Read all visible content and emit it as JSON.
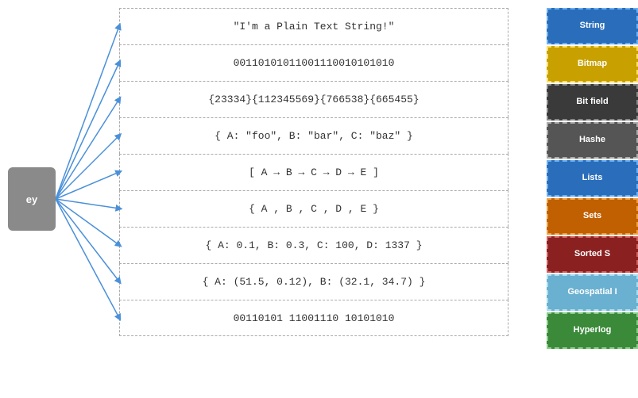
{
  "key": {
    "label": "ey"
  },
  "data_items": [
    {
      "id": "string-data",
      "text": "\"I'm a Plain Text String!\""
    },
    {
      "id": "bitmap-data",
      "text": "00110101011001110010101010"
    },
    {
      "id": "bitfield-data",
      "text": "{23334}{112345569}{766538}{665455}"
    },
    {
      "id": "hash-data",
      "text": "{ A: \"foo\", B: \"bar\", C: \"baz\" }"
    },
    {
      "id": "list-data",
      "text": "[ A → B → C → D → E ]"
    },
    {
      "id": "set-data",
      "text": "{ A , B , C , D , E }"
    },
    {
      "id": "sortedset-data",
      "text": "{ A: 0.1, B: 0.3, C: 100, D: 1337 }"
    },
    {
      "id": "geospatial-data",
      "text": "{ A: (51.5, 0.12), B: (32.1, 34.7) }"
    },
    {
      "id": "hyperlog-data",
      "text": "00110101 11001110 10101010"
    }
  ],
  "type_items": [
    {
      "id": "string-type",
      "label": "String",
      "colorClass": "type-string"
    },
    {
      "id": "bitmap-type",
      "label": "Bitmap",
      "colorClass": "type-bitmap"
    },
    {
      "id": "bitfield-type",
      "label": "Bit field",
      "colorClass": "type-bitfield"
    },
    {
      "id": "hash-type",
      "label": "Hashe",
      "colorClass": "type-hash"
    },
    {
      "id": "list-type",
      "label": "Lists",
      "colorClass": "type-list"
    },
    {
      "id": "set-type",
      "label": "Sets",
      "colorClass": "type-set"
    },
    {
      "id": "sortedset-type",
      "label": "Sorted S",
      "colorClass": "type-sortedset"
    },
    {
      "id": "geospatial-type",
      "label": "Geospatial I",
      "colorClass": "type-geospatial"
    },
    {
      "id": "hyperlog-type",
      "label": "Hyperlog",
      "colorClass": "type-hyperlog"
    }
  ],
  "colors": {
    "line_color": "#4a90d9",
    "dashed_border": "#aaaaaa"
  }
}
